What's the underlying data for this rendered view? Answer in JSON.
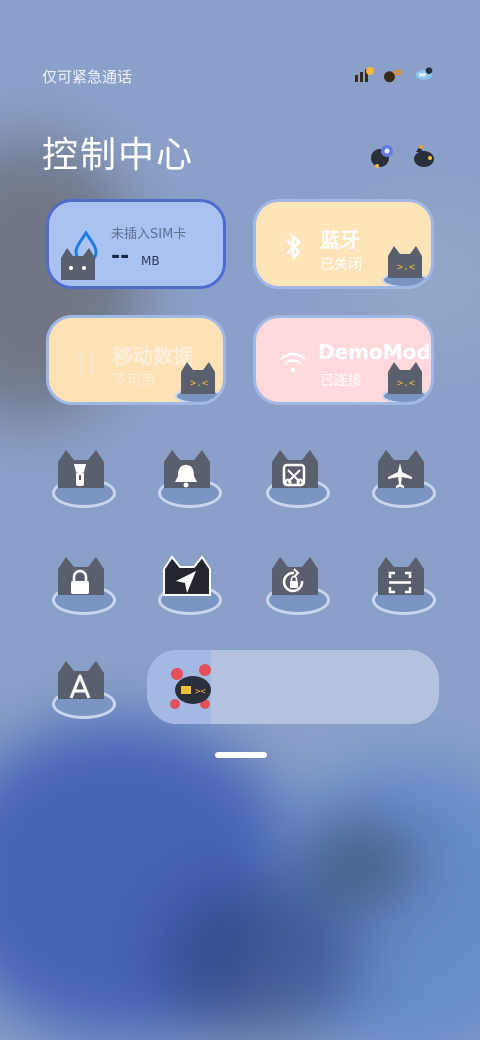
{
  "status": {
    "carrier": "仅可紧急通话"
  },
  "header": {
    "title": "控制中心"
  },
  "tiles": {
    "data_usage": {
      "title": "未插入SIM卡",
      "value": "--",
      "unit": "MB"
    },
    "bluetooth": {
      "label": "蓝牙",
      "status": "已关闭"
    },
    "mobile_data": {
      "label": "移动数据",
      "status": "不可用"
    },
    "wifi": {
      "label": "DemoMod",
      "status": "已连接"
    }
  },
  "toggles": [
    {
      "name": "flashlight-icon"
    },
    {
      "name": "bell-icon"
    },
    {
      "name": "screenshot-icon"
    },
    {
      "name": "airplane-icon"
    },
    {
      "name": "lock-icon"
    },
    {
      "name": "location-icon"
    },
    {
      "name": "rotation-lock-icon"
    },
    {
      "name": "scanner-icon"
    },
    {
      "name": "font-a-icon"
    }
  ],
  "brightness": {
    "level": 0.22
  },
  "colors": {
    "data_tile": "#a9c2f2",
    "data_tile_border": "#4f6ccc",
    "bt_tile": "#fde4b9",
    "mobile_tile": "#fde2b5",
    "wifi_tile": "#ffd9dc",
    "tile_border": "#9fb8e6",
    "accent_blue": "#1e7be6"
  }
}
